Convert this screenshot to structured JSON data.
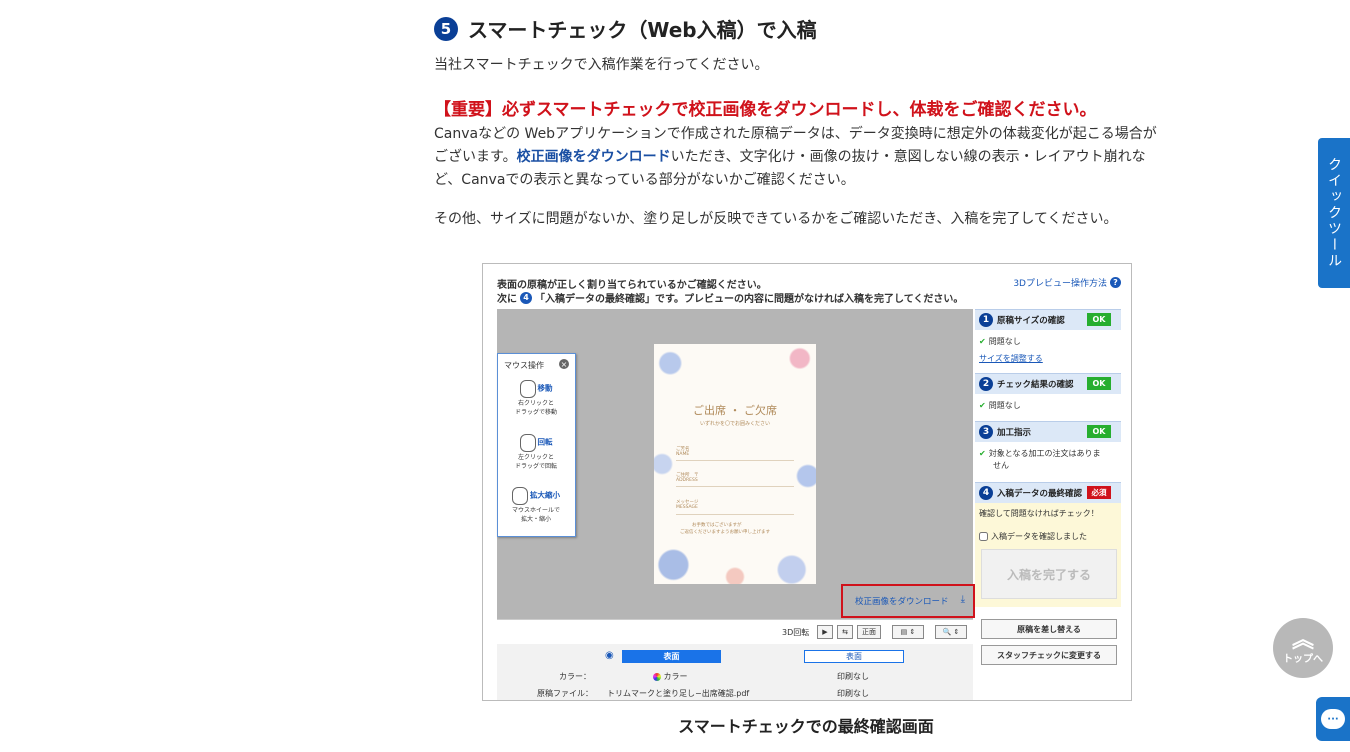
{
  "section": {
    "number": "5",
    "title": "スマートチェック（Web入稿）で入稿",
    "intro": "当社スマートチェックで入稿作業を行ってください。",
    "warning": "【重要】必ずスマートチェックで校正画像をダウンロードし、体裁をご確認ください。",
    "para1_a": "Canvaなどの Webアプリケーションで作成された原稿データは、データ変換時に想定外の体裁変化が起こる場合が",
    "para1_b_pre": "ございます。",
    "para1_b_link": "校正画像をダウンロード",
    "para1_b_post": "いただき、文字化け・画像の抜け・意図しない線の表示・レイアウト崩れな",
    "para1_c": "ど、Canvaでの表示と異なっている部分がないかご確認ください。",
    "para2": "その他、サイズに問題がないか、塗り足しが反映できているかをご確認いただき、入稿を完了してください。",
    "caption": "スマートチェックでの最終確認画面"
  },
  "screenshot": {
    "line1": "表面の原稿が正しく割り当てられているかご確認ください。",
    "line2_pre": "次に",
    "line2_num": "4",
    "line2_post": "「入稿データの最終確認」です。プレビューの内容に問題がなければ入稿を完了してください。",
    "help_link": "3Dプレビュー操作方法",
    "help_icon": "?",
    "mouse_panel": {
      "title": "マウス操作",
      "close": "×",
      "items": [
        {
          "label": "移動",
          "desc1": "右クリックと",
          "desc2": "ドラッグで移動"
        },
        {
          "label": "回転",
          "desc1": "左クリックと",
          "desc2": "ドラッグで回転"
        },
        {
          "label": "拡大縮小",
          "desc1": "マウスホイールで",
          "desc2": "拡大・縮小"
        }
      ]
    },
    "card": {
      "title": "ご出席 ・ ご欠席",
      "sub": "いずれかを〇でお囲みください",
      "l1": "ご芳名",
      "l1b": "NAME",
      "l2": "ご住所　〒",
      "l2b": "ADDRESS",
      "l3": "メッセージ",
      "l3b": "MESSAGE",
      "l4": "お手数ではございますが",
      "l5": "ご返信くださいますようお願い申し上げます"
    },
    "download_label": "校正画像をダウンロード",
    "download_icon": "⤓",
    "toolbar": {
      "label": "3D回転",
      "play": "▶",
      "flip": "⇆",
      "front": "正面",
      "view": "▤ ⇕",
      "zoom": "🔍 ⇕"
    },
    "bottom": {
      "tab_active": "表面",
      "tab_inactive": "表面",
      "row1_label": "カラー：",
      "row1_value": "カラー",
      "row1_right": "印刷なし",
      "row2_label": "原稿ファイル：",
      "row2_value": "トリムマークと塗り足し−出席確認.pdf",
      "row2_right": "印刷なし"
    },
    "side": {
      "s1": {
        "num": "1",
        "title": "原稿サイズの確認",
        "badge": "OK",
        "status": "問題なし",
        "link": "サイズを調整する"
      },
      "s2": {
        "num": "2",
        "title": "チェック結果の確認",
        "badge": "OK",
        "status": "問題なし"
      },
      "s3": {
        "num": "3",
        "title": "加工指示",
        "badge": "OK",
        "status1": "対象となる加工の注文はありま",
        "status2": "せん"
      },
      "s4": {
        "num": "4",
        "title": "入稿データの最終確認",
        "badge": "必須",
        "prompt": "確認して問題なければチェック！",
        "checkbox": "入稿データを確認しました",
        "complete": "入稿を完了する"
      },
      "replace": "原稿を差し替える",
      "staff": "スタッフチェックに変更する"
    }
  },
  "widgets": {
    "quick_tool": "クイックツール",
    "to_top_arrow": "︽",
    "to_top": "トップへ",
    "chat_icon": "···"
  },
  "colors": {
    "accent_blue": "#1a73c8",
    "warning_red": "#d0121b",
    "ok_green": "#27ae2f",
    "badge_navy": "#0a3f96"
  }
}
